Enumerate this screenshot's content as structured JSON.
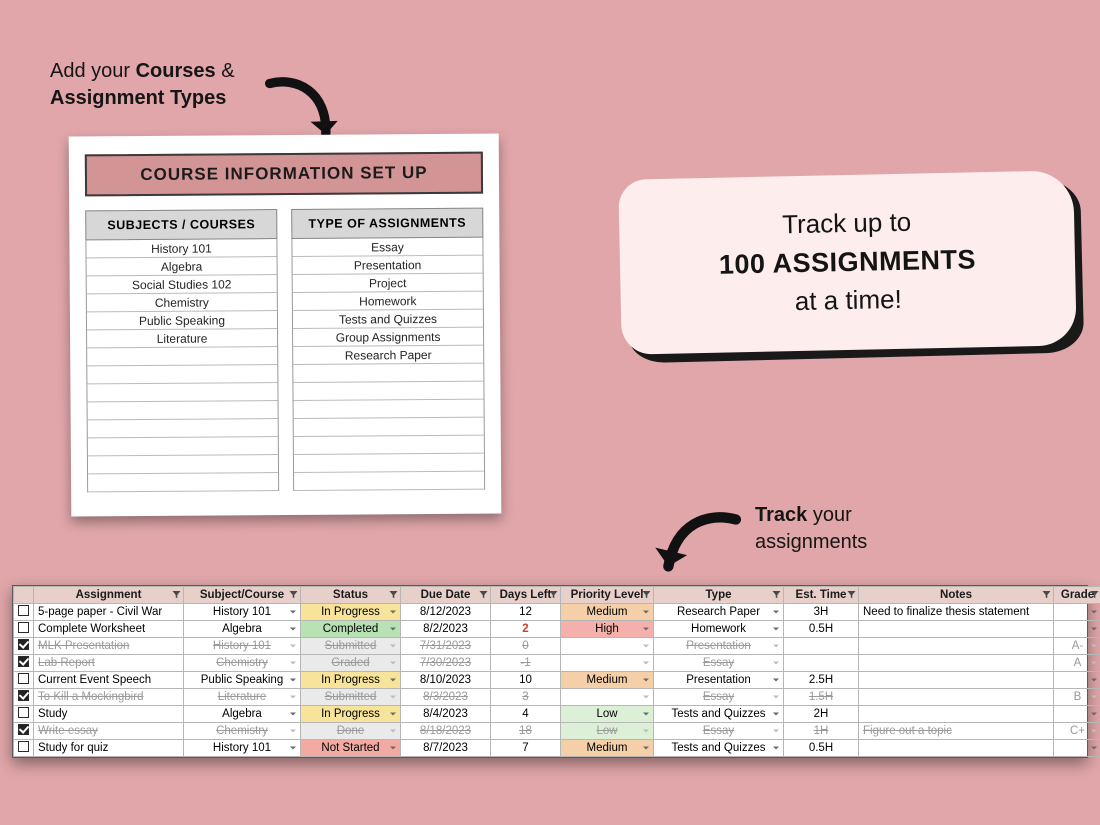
{
  "annotations": {
    "top_line1_a": "Add your ",
    "top_line1_b": "Courses",
    "top_line1_c": " &",
    "top_line2": "Assignment Types",
    "right_line1_a": "Track",
    "right_line1_b": " your",
    "right_line2": "assignments"
  },
  "bubble": {
    "line1": "Track up to",
    "line2": "100 ASSIGNMENTS",
    "line3": "at a time!"
  },
  "panel": {
    "title": "COURSE INFORMATION SET UP",
    "col1_header": "SUBJECTS / COURSES",
    "col2_header": "TYPE OF ASSIGNMENTS",
    "subjects": [
      "History 101",
      "Algebra",
      "Social Studies 102",
      "Chemistry",
      "Public Speaking",
      "Literature",
      "",
      "",
      "",
      "",
      "",
      "",
      "",
      ""
    ],
    "types": [
      "Essay",
      "Presentation",
      "Project",
      "Homework",
      "Tests and Quizzes",
      "Group Assignments",
      "Research Paper",
      "",
      "",
      "",
      "",
      "",
      "",
      ""
    ]
  },
  "tracker": {
    "headers": {
      "assignment": "Assignment",
      "subject": "Subject/Course",
      "status": "Status",
      "due": "Due Date",
      "daysleft": "Days Left",
      "priority": "Priority Level",
      "type": "Type",
      "est": "Est. Time",
      "notes": "Notes",
      "grade": "Grade"
    },
    "rows": [
      {
        "checked": false,
        "done": false,
        "assignment": "5-page paper - Civil War",
        "subject": "History 101",
        "status": "In Progress",
        "status_cls": "st-inprogress",
        "due": "8/12/2023",
        "daysleft": "12",
        "daysleft_cls": "",
        "priority": "Medium",
        "priority_cls": "pr-med",
        "type": "Research Paper",
        "est": "3H",
        "notes": "Need to finalize thesis statement",
        "grade": ""
      },
      {
        "checked": false,
        "done": false,
        "assignment": "Complete Worksheet",
        "subject": "Algebra",
        "status": "Completed",
        "status_cls": "st-completed",
        "due": "8/2/2023",
        "daysleft": "2",
        "daysleft_cls": "due-red",
        "priority": "High",
        "priority_cls": "pr-high",
        "type": "Homework",
        "est": "0.5H",
        "notes": "",
        "grade": ""
      },
      {
        "checked": true,
        "done": true,
        "assignment": "MLK Presentation",
        "subject": "History 101",
        "status": "Submitted",
        "status_cls": "st-submitted",
        "due": "7/31/2023",
        "daysleft": "0",
        "daysleft_cls": "",
        "priority": "",
        "priority_cls": "",
        "type": "Presentation",
        "est": "",
        "notes": "",
        "grade": "A-"
      },
      {
        "checked": true,
        "done": true,
        "assignment": "Lab Report",
        "subject": "Chemistry",
        "status": "Graded",
        "status_cls": "st-graded",
        "due": "7/30/2023",
        "daysleft": "-1",
        "daysleft_cls": "",
        "priority": "",
        "priority_cls": "",
        "type": "Essay",
        "est": "",
        "notes": "",
        "grade": "A"
      },
      {
        "checked": false,
        "done": false,
        "assignment": "Current Event Speech",
        "subject": "Public Speaking",
        "status": "In Progress",
        "status_cls": "st-inprogress",
        "due": "8/10/2023",
        "daysleft": "10",
        "daysleft_cls": "",
        "priority": "Medium",
        "priority_cls": "pr-med",
        "type": "Presentation",
        "est": "2.5H",
        "notes": "",
        "grade": ""
      },
      {
        "checked": true,
        "done": true,
        "assignment": "To Kill a Mockingbird",
        "subject": "Literature",
        "status": "Submitted",
        "status_cls": "st-submitted",
        "due": "8/3/2023",
        "daysleft": "3",
        "daysleft_cls": "",
        "priority": "",
        "priority_cls": "",
        "type": "Essay",
        "est": "1.5H",
        "notes": "",
        "grade": "B"
      },
      {
        "checked": false,
        "done": false,
        "assignment": "Study",
        "subject": "Algebra",
        "status": "In Progress",
        "status_cls": "st-inprogress",
        "due": "8/4/2023",
        "daysleft": "4",
        "daysleft_cls": "",
        "priority": "Low",
        "priority_cls": "pr-low",
        "type": "Tests and Quizzes",
        "est": "2H",
        "notes": "",
        "grade": ""
      },
      {
        "checked": true,
        "done": true,
        "assignment": "Write essay",
        "subject": "Chemistry",
        "status": "Done",
        "status_cls": "st-done",
        "due": "8/18/2023",
        "daysleft": "18",
        "daysleft_cls": "",
        "priority": "Low",
        "priority_cls": "pr-low",
        "type": "Essay",
        "est": "1H",
        "notes": "Figure out a topic",
        "grade": "C+"
      },
      {
        "checked": false,
        "done": false,
        "assignment": "Study for quiz",
        "subject": "History 101",
        "status": "Not Started",
        "status_cls": "st-notstarted",
        "due": "8/7/2023",
        "daysleft": "7",
        "daysleft_cls": "",
        "priority": "Medium",
        "priority_cls": "pr-med",
        "type": "Tests and Quizzes",
        "est": "0.5H",
        "notes": "",
        "grade": ""
      }
    ]
  }
}
